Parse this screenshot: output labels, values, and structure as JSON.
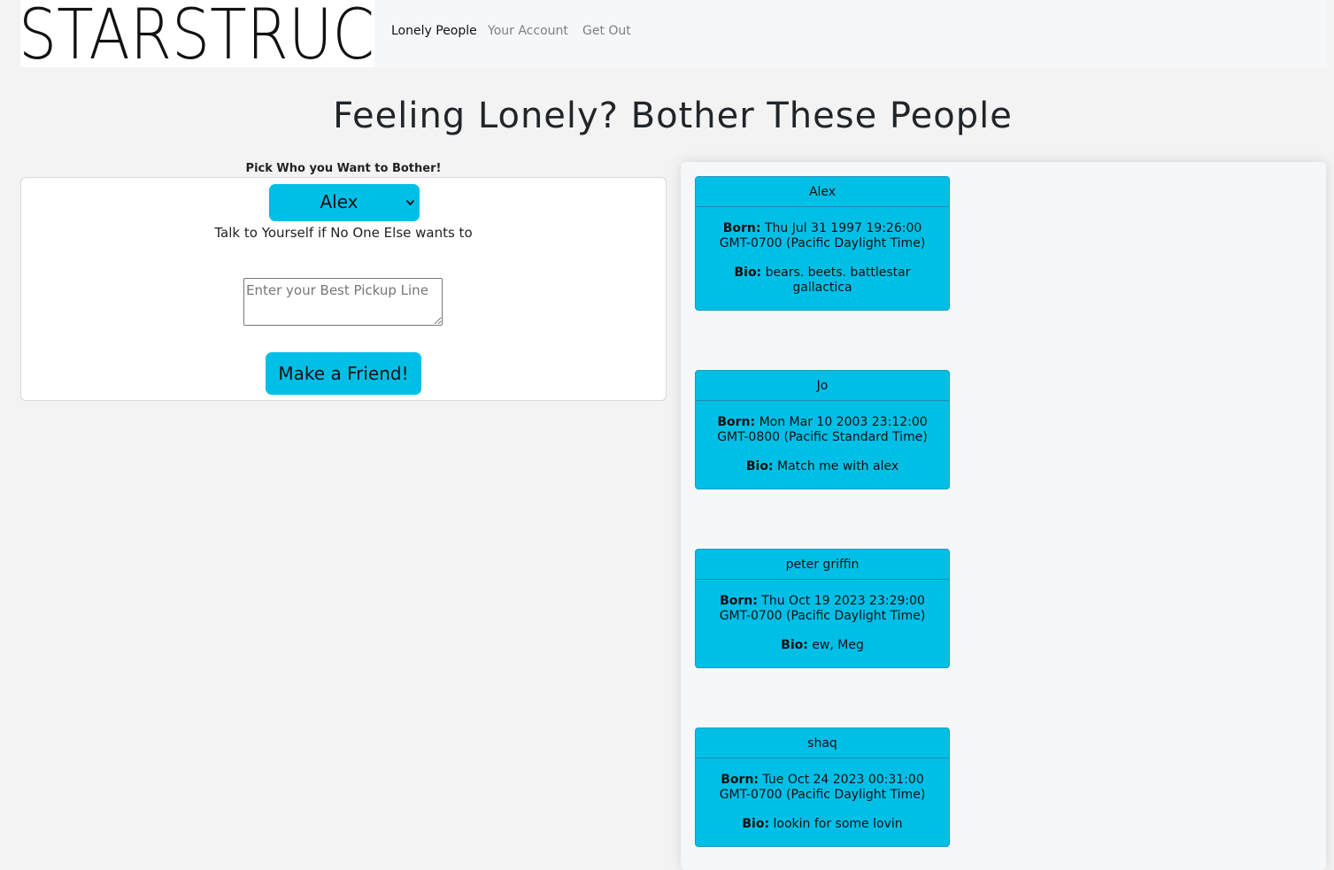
{
  "brand": {
    "name": "STARSTRUC"
  },
  "nav": {
    "items": [
      {
        "label": "Lonely People",
        "active": true
      },
      {
        "label": "Your Account",
        "active": false
      },
      {
        "label": "Get Out",
        "active": false
      }
    ]
  },
  "page": {
    "title": "Feeling Lonely? Bother These People"
  },
  "form": {
    "pick_label": "Pick Who you Want to Bother!",
    "select": {
      "selected": "Alex"
    },
    "hint": "Talk to Yourself if No One Else wants to",
    "textarea": {
      "placeholder": "Enter your Best Pickup Line",
      "value": ""
    },
    "submit_label": "Make a Friend!"
  },
  "labels": {
    "born": "Born:",
    "bio": "Bio:"
  },
  "profiles": [
    {
      "name": "Alex",
      "born": "Thu Jul 31 1997 19:26:00 GMT-0700 (Pacific Daylight Time)",
      "bio": "bears. beets. battlestar gallactica"
    },
    {
      "name": "Jo",
      "born": "Mon Mar 10 2003 23:12:00 GMT-0800 (Pacific Standard Time)",
      "bio": "Match me with alex"
    },
    {
      "name": "peter griffin",
      "born": "Thu Oct 19 2023 23:29:00 GMT-0700 (Pacific Daylight Time)",
      "bio": "ew, Meg"
    },
    {
      "name": "shaq",
      "born": "Tue Oct 24 2023 00:31:00 GMT-0700 (Pacific Daylight Time)",
      "bio": "lookin for some lovin"
    }
  ],
  "colors": {
    "accent": "#00bfe6",
    "navbar_bg": "#f6f7f9",
    "page_bg": "#f3f3f3"
  }
}
